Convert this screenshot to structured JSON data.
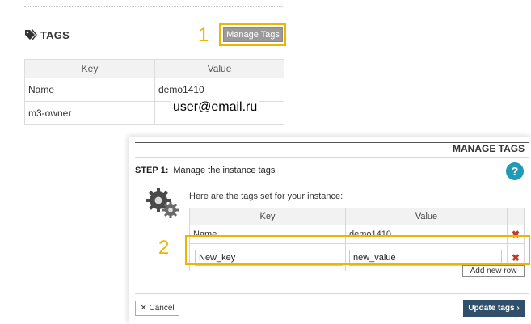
{
  "tags_panel": {
    "title": "TAGS",
    "tag_icon": "tag-icon",
    "step_number": "1",
    "manage_button": "Manage Tags",
    "columns": [
      "Key",
      "Value"
    ],
    "rows": [
      {
        "key": "Name",
        "value": "demo1410"
      },
      {
        "key": "m3-owner",
        "value": "user@email.ru"
      }
    ]
  },
  "dialog": {
    "title": "MANAGE TAGS",
    "step_prefix": "STEP 1:",
    "step_text": "Manage the instance tags",
    "help_icon": "help-icon",
    "help_glyph": "?",
    "gears_icon": "gears-icon",
    "intro": "Here are the tags set for your instance:",
    "columns": [
      "Key",
      "Value"
    ],
    "rows": [
      {
        "key": "Name",
        "value": "demo1410"
      },
      {
        "key": "New_key",
        "value": "new_value"
      }
    ],
    "delete_glyph": "✖",
    "step_number": "2",
    "add_row_button": "Add new row",
    "cancel_button": "✕ Cancel",
    "update_button": "Update tags ›"
  },
  "colors": {
    "highlight": "#f0b400",
    "help": "#1e9bb8",
    "primary_button": "#2f4f6a",
    "delete": "#c0392b"
  }
}
